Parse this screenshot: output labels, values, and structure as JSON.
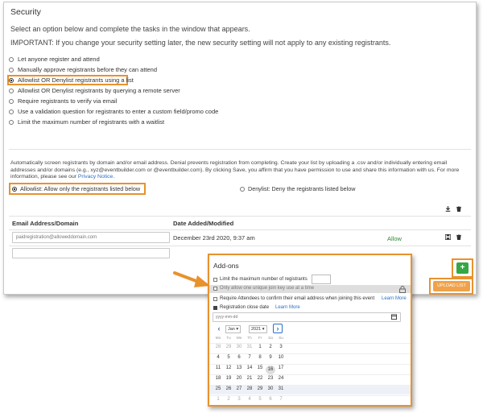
{
  "security": {
    "title": "Security",
    "subtitle": "Select an option below and complete the tasks in the window that appears.",
    "important": "IMPORTANT:  If you change your security setting later, the new security setting will not apply to any existing registrants.",
    "options": [
      {
        "label": "Let anyone register and attend",
        "selected": false
      },
      {
        "label": "Manually approve registrants before they can attend",
        "selected": false
      },
      {
        "label": "Allowlist OR Denylist registrants using a list",
        "selected": true
      },
      {
        "label": "Allowlist OR Denylist registrants by querying a remote server",
        "selected": false
      },
      {
        "label": "Require registrants to verify via email",
        "selected": false
      },
      {
        "label": "Use a validation question for registrants to enter a custom field/promo code",
        "selected": false
      },
      {
        "label": "Limit the maximum number of registrants with a waitlist",
        "selected": false
      }
    ]
  },
  "list": {
    "description": "Automatically screen registrants by domain and/or email address. Denial prevents registration from completing. Create your list by uploading a .csv and/or individually entering email addresses and/or domains (e.g., xyz@eventbuilder.com or @eventbuilder.com). By clicking Save, you affirm that you have permission to use and share this information with us. For more information, please see our",
    "privacy_link": "Privacy Notice",
    "allowlist_label": "Allowlist: Allow only the registrants listed below",
    "denylist_label": "Denylist: Deny the registrants listed below",
    "col_email": "Email Address/Domain",
    "col_date": "Date Added/Modified",
    "rows": [
      {
        "email": "paidregistration@alloweddomain.com",
        "date": "December 23rd 2020, 9:37 am",
        "status": "Allow"
      }
    ],
    "add_label": "+",
    "upload_label": "UPLOAD LIST"
  },
  "addons": {
    "title": "Add-ons",
    "limit_label": "Limit the maximum number of registrants",
    "unique_key_label": "Only allow one unique join key use at a time",
    "confirm_label": "Require Attendees to confirm their email address when joining this event",
    "learn_more": "Learn More",
    "close_label": "Registration close date",
    "date_placeholder": "yyyy-mm-dd",
    "month": "Jan",
    "year": "2021",
    "weekdays": [
      "Mo",
      "Tu",
      "We",
      "Th",
      "Fr",
      "Sa",
      "Su"
    ],
    "weeks": [
      [
        {
          "d": "28",
          "m": true
        },
        {
          "d": "29",
          "m": true
        },
        {
          "d": "30",
          "m": true
        },
        {
          "d": "31",
          "m": true
        },
        {
          "d": "1",
          "m": false
        },
        {
          "d": "2",
          "m": false
        },
        {
          "d": "3",
          "m": false
        }
      ],
      [
        {
          "d": "4",
          "m": false
        },
        {
          "d": "5",
          "m": false
        },
        {
          "d": "6",
          "m": false
        },
        {
          "d": "7",
          "m": false
        },
        {
          "d": "8",
          "m": false
        },
        {
          "d": "9",
          "m": false
        },
        {
          "d": "10",
          "m": false
        }
      ],
      [
        {
          "d": "11",
          "m": false
        },
        {
          "d": "12",
          "m": false
        },
        {
          "d": "13",
          "m": false
        },
        {
          "d": "14",
          "m": false
        },
        {
          "d": "15",
          "m": false
        },
        {
          "d": "16",
          "m": false,
          "s": true
        },
        {
          "d": "17",
          "m": false
        }
      ],
      [
        {
          "d": "18",
          "m": false
        },
        {
          "d": "19",
          "m": false
        },
        {
          "d": "20",
          "m": false
        },
        {
          "d": "21",
          "m": false
        },
        {
          "d": "22",
          "m": false
        },
        {
          "d": "23",
          "m": false
        },
        {
          "d": "24",
          "m": false
        }
      ],
      [
        {
          "d": "25",
          "m": false
        },
        {
          "d": "26",
          "m": false
        },
        {
          "d": "27",
          "m": false
        },
        {
          "d": "28",
          "m": false
        },
        {
          "d": "29",
          "m": false
        },
        {
          "d": "30",
          "m": false
        },
        {
          "d": "31",
          "m": false
        }
      ],
      [
        {
          "d": "1",
          "m": true
        },
        {
          "d": "2",
          "m": true
        },
        {
          "d": "3",
          "m": true
        },
        {
          "d": "4",
          "m": true
        },
        {
          "d": "5",
          "m": true
        },
        {
          "d": "6",
          "m": true
        },
        {
          "d": "7",
          "m": true
        }
      ]
    ]
  },
  "colors": {
    "highlight": "#e8922d",
    "accent_green": "#35a745",
    "link": "#2a6fc9"
  }
}
